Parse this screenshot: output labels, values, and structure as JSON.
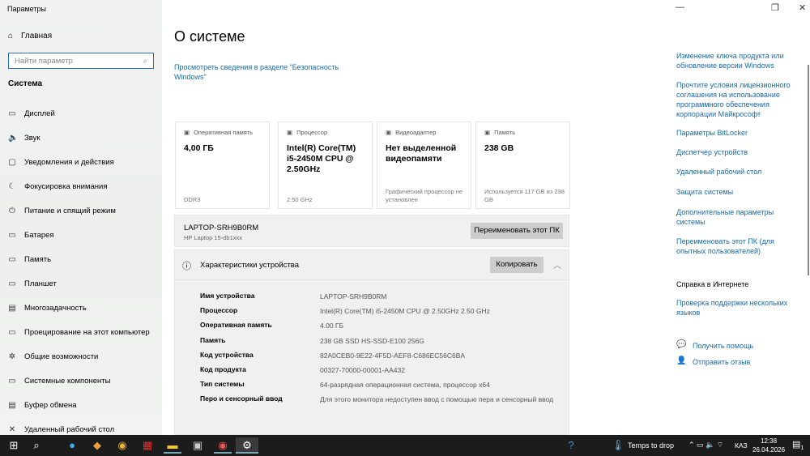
{
  "window": {
    "title": "Параметры",
    "minimize": "—",
    "maximize": "❐",
    "close": "✕"
  },
  "sidebar": {
    "home": "Главная",
    "search_placeholder": "Найти параметр",
    "section": "Система",
    "items": [
      {
        "label": "Дисплей",
        "icon": "▭"
      },
      {
        "label": "Звук",
        "icon": "🔈"
      },
      {
        "label": "Уведомления и действия",
        "icon": "▢"
      },
      {
        "label": "Фокусировка внимания",
        "icon": "☾"
      },
      {
        "label": "Питание и спящий режим",
        "icon": "⏻"
      },
      {
        "label": "Батарея",
        "icon": "▭"
      },
      {
        "label": "Память",
        "icon": "▭"
      },
      {
        "label": "Планшет",
        "icon": "▭"
      },
      {
        "label": "Многозадачность",
        "icon": "▤"
      },
      {
        "label": "Проецирование на этот компьютер",
        "icon": "▭"
      },
      {
        "label": "Общие возможности",
        "icon": "✲"
      },
      {
        "label": "Системные компоненты",
        "icon": "▭"
      },
      {
        "label": "Буфер обмена",
        "icon": "▤"
      },
      {
        "label": "Удаленный рабочий стол",
        "icon": "✕"
      }
    ]
  },
  "main": {
    "title": "О системе",
    "security_link": "Просмотреть сведения в разделе \"Безопасность Windows\"",
    "cards": [
      {
        "header": "Оперативная память",
        "value": "4,00 ГБ",
        "sub": "DDR3"
      },
      {
        "header": "Процессор",
        "value": "Intel(R) Core(TM) i5-2450M CPU @ 2.50GHz",
        "sub": "2.50 GHz"
      },
      {
        "header": "Видеоадаптер",
        "value": "Нет выделенной видеопамяти",
        "sub": "Графический процессор не установлен"
      },
      {
        "header": "Память",
        "value": "238 GB",
        "sub": "Используется 117 GB из 238 GB"
      }
    ],
    "pc_name": "LAPTOP-SRH9B0RM",
    "pc_model": "HP Laptop 15-db1xxx",
    "rename_button": "Переименовать этот ПК",
    "specs_title": "Характеристики устройства",
    "copy_button": "Копировать",
    "specs": [
      {
        "k": "Имя устройства",
        "v": "LAPTOP-SRH9B0RM"
      },
      {
        "k": "Процессор",
        "v": "Intel(R) Core(TM) i5-2450M CPU @ 2.50GHz   2.50 GHz"
      },
      {
        "k": "Оперативная память",
        "v": "4.00 ГБ"
      },
      {
        "k": "Память",
        "v": "238 GB SSD HS-SSD-E100 256G"
      },
      {
        "k": "Код устройства",
        "v": "82A0CEB0-9E22-4F5D-AEF8-C686EC56C6BA"
      },
      {
        "k": "Код продукта",
        "v": "00327-70000-00001-AA432"
      },
      {
        "k": "Тип системы",
        "v": "64-разрядная операционная система, процессор x64"
      },
      {
        "k": "Перо и сенсорный ввод",
        "v": "Для этого монитора недоступен ввод с помощью пера и сенсорный ввод"
      }
    ]
  },
  "related": {
    "links": [
      "Изменение ключа продукта или обновление версии Windows",
      "Прочтите условия лицензионного соглашения на использование программного обеспечения корпорации Майкрософт",
      "Параметры BitLocker",
      "Диспетчер устройств",
      "Удаленный рабочий стол",
      "Защита системы",
      "Дополнительные параметры системы",
      "Переименовать этот ПК (для опытных пользователей)"
    ],
    "help_title": "Справка в Интернете",
    "help_link": "Проверка поддержки нескольких языков",
    "get_help": "Получить помощь",
    "feedback": "Отправить отзыв"
  },
  "taskbar": {
    "weather": "Temps to drop",
    "lang": "КАЗ",
    "time": "12:38",
    "date": "26.04.2026",
    "notif_count": "1"
  }
}
